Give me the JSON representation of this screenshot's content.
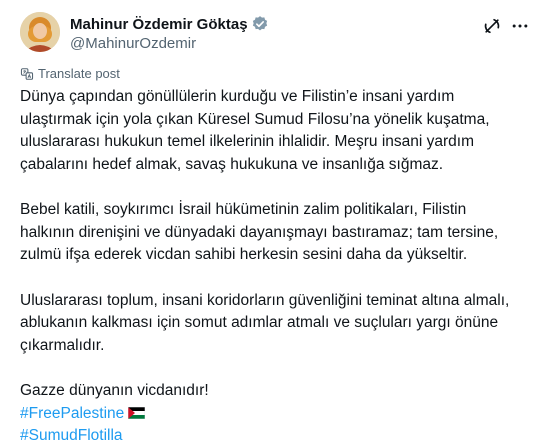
{
  "author": {
    "display_name": "Mahinur Özdemir Göktaş",
    "handle": "@MahinurOzdemir"
  },
  "icons": {
    "verified": "verified-badge-icon",
    "grok": "grok-icon",
    "more": "more-options-icon",
    "translate": "translate-icon",
    "flag": "palestine-flag-icon"
  },
  "colors": {
    "text": "#0f1419",
    "muted": "#536471",
    "link": "#1d9bf0"
  },
  "translate_label": "Translate post",
  "paragraphs": [
    {
      "lines": [
        "Dünya çapından gönüllülerin kurduğu ve Filistin’e insani yardım",
        "ulaştırmak için yola çıkan Küresel Sumud Filosu’na yönelik kuşatma,",
        "uluslararası hukukun temel ilkelerinin ihlalidir. Meşru insani yardım",
        "çabalarını hedef almak, savaş hukukuna ve insanlığa sığmaz."
      ]
    },
    {
      "lines": [
        "Bebel katili, soykırımcı İsrail hükümetinin zalim politikaları, Filistin",
        "halkının direnişini ve dünyadaki dayanışmayı bastıramaz; tam tersine,",
        "zulmü ifşa ederek vicdan sahibi herkesin sesini daha da yükseltir."
      ]
    },
    {
      "lines": [
        "Uluslararası toplum, insani koridorların güvenliğini teminat altına almalı,",
        "ablukanın kalkması için somut adımlar atmalı ve suçluları yargı önüne",
        "çıkarmalıdır."
      ]
    }
  ],
  "closing_line": "Gazze dünyanın vicdanıdır!",
  "hashtags": [
    "#FreePalestine",
    "#SumudFlotilla"
  ]
}
